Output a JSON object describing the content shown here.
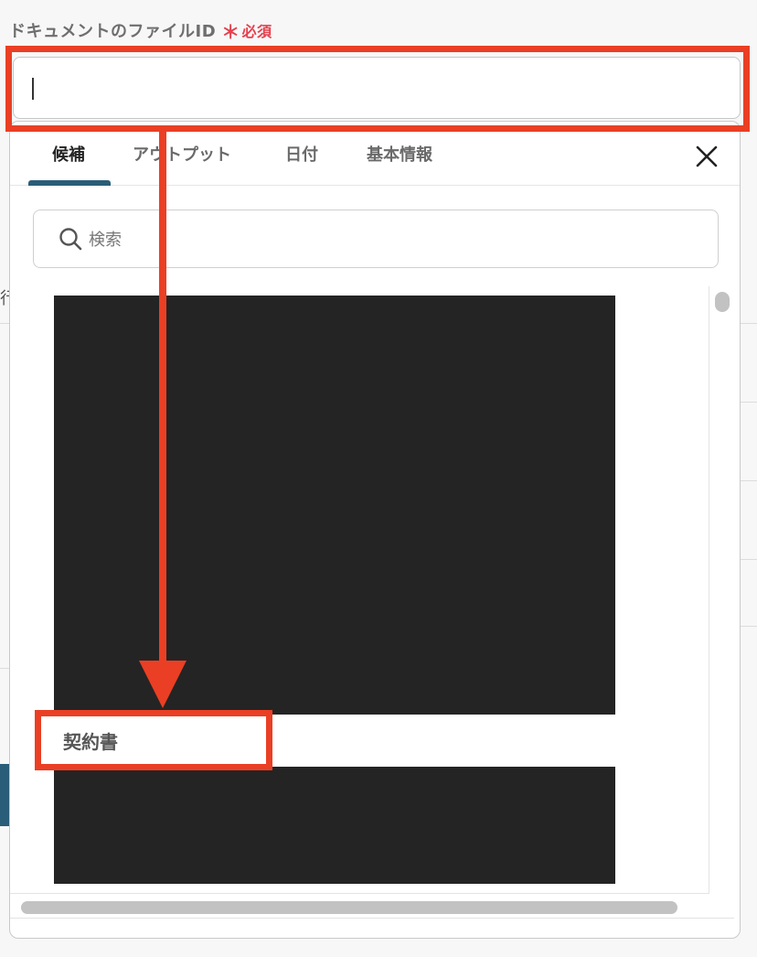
{
  "field": {
    "label": "ドキュメントのファイルID",
    "required_mark": "＊",
    "required_text": "必須",
    "value": ""
  },
  "background": {
    "partial_text": "行"
  },
  "panel": {
    "tabs": [
      {
        "label": "候補",
        "active": true
      },
      {
        "label": "アウトプット",
        "active": false
      },
      {
        "label": "日付",
        "active": false
      },
      {
        "label": "基本情報",
        "active": false
      }
    ],
    "close_icon": "close-icon",
    "search": {
      "placeholder": "検索",
      "value": ""
    },
    "items": [
      {
        "label": "",
        "redacted": true
      },
      {
        "label": "契約書",
        "redacted": false
      },
      {
        "label": "",
        "redacted": true
      }
    ]
  },
  "colors": {
    "highlight": "#ea3f24",
    "required": "#e5404d",
    "tab_accent": "#2a5d78",
    "redaction": "#242424"
  }
}
